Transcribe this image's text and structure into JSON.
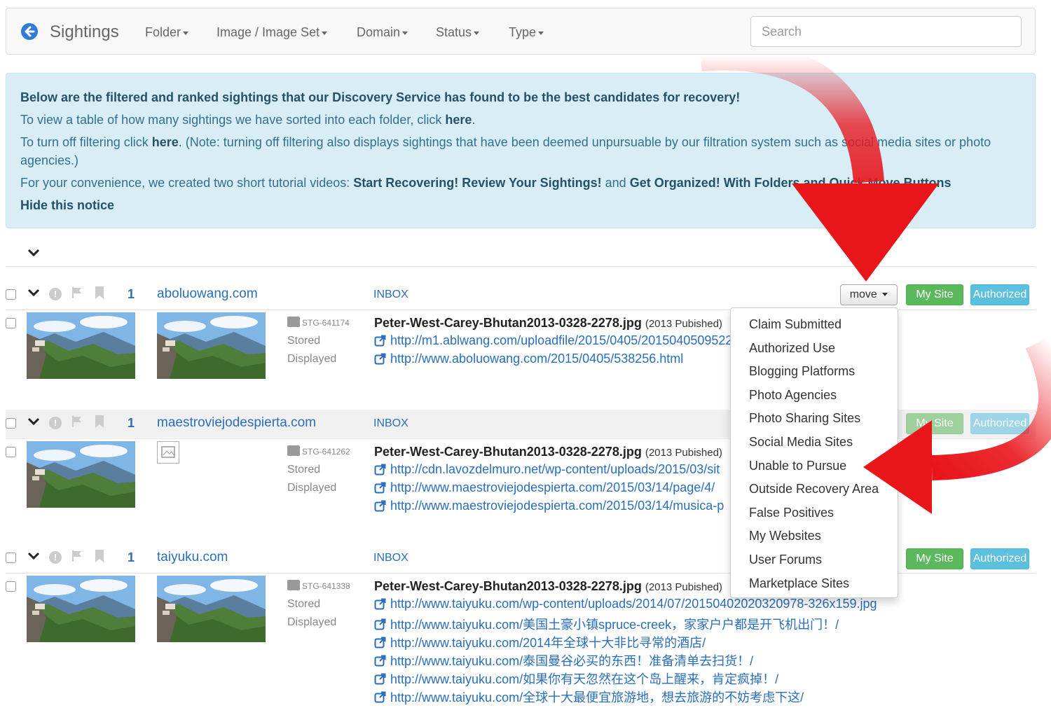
{
  "nav": {
    "brand": "Sightings",
    "menus": [
      "Folder",
      "Image / Image Set",
      "Domain",
      "Status",
      "Type"
    ],
    "search_placeholder": "Search"
  },
  "notice": {
    "line1": "Below are the filtered and ranked sightings that our Discovery Service has found to be the best candidates for recovery!",
    "line2_a": "To view a table of how many sightings we have sorted into each folder, click ",
    "line2_link": "here",
    "line2_b": ".",
    "line3_a": "To turn off filtering click ",
    "line3_link": "here",
    "line3_b": ". (Note: turning off filtering also displays sightings that have been deemed unpursuable by our filtration system such as social media sites or photo",
    "line3_c": "agencies.)",
    "line4_a": "For your convenience, we created two short tutorial videos: ",
    "line4_link1": "Start Recovering! Review Your Sightings!",
    "line4_and": " and ",
    "line4_link2": "Get Organized! With Folders and Quick Move Buttons",
    "hide": "Hide this notice"
  },
  "buttons": {
    "move": "move",
    "my_site": "My Site",
    "authorized": "Authorized"
  },
  "sightings": [
    {
      "count": "1",
      "domain": "aboluowang.com",
      "folder": "INBOX",
      "stg_id": "STG-641174",
      "stored": "Stored",
      "displayed": "Displayed",
      "filename": "Peter-West-Carey-Bhutan2013-0328-2278.jpg",
      "published": "(2013 Pubished)",
      "urls": [
        "http://m1.ablwang.com/uploadfile/2015/0405/2015040509522",
        "http://www.aboluowang.com/2015/0405/538256.html"
      ]
    },
    {
      "count": "1",
      "domain": "maestroviejodespierta.com",
      "folder": "INBOX",
      "stg_id": "STG-641262",
      "stored": "Stored",
      "displayed": "Displayed",
      "filename": "Peter-West-Carey-Bhutan2013-0328-2278.jpg",
      "published": "(2013 Pubished)",
      "urls": [
        "http://cdn.lavozdelmuro.net/wp-content/uploads/2015/03/sit",
        "http://www.maestroviejodespierta.com/2015/03/14/page/4/",
        "http://www.maestroviejodespierta.com/2015/03/14/musica-p"
      ]
    },
    {
      "count": "1",
      "domain": "taiyuku.com",
      "folder": "INBOX",
      "stg_id": "STG-641338",
      "stored": "Stored",
      "displayed": "Displayed",
      "filename": "Peter-West-Carey-Bhutan2013-0328-2278.jpg",
      "published": "(2013 Pubished)",
      "urls": [
        "http://www.taiyuku.com/wp-content/uploads/2014/07/20150402020320978-326x159.jpg",
        "http://www.taiyuku.com/美国土豪小镇spruce-creek，家家户户都是开飞机出门！/",
        "http://www.taiyuku.com/2014年全球十大非比寻常的酒店/",
        "http://www.taiyuku.com/泰国曼谷必买的东西！准备清单去扫货！/",
        "http://www.taiyuku.com/如果你有天忽然在这个岛上醒来，肯定疯掉！/",
        "http://www.taiyuku.com/全球十大最便宜旅游地，想去旅游的不妨考虑下这/"
      ]
    }
  ],
  "move_menu": [
    "Claim Submitted",
    "Authorized Use",
    "Blogging Platforms",
    "Photo Agencies",
    "Photo Sharing Sites",
    "Social Media Sites",
    "Unable to Pursue",
    "Outside Recovery Area",
    "False Positives",
    "My Websites",
    "User Forums",
    "Marketplace Sites"
  ],
  "colors": {
    "arrow": "#e8151b",
    "link": "#2a6ebb",
    "notice_bg": "#d9edf7",
    "success": "#5cb85c",
    "info": "#5bc0de"
  },
  "icons": [
    "back-arrow-icon",
    "chevron-down-icon",
    "exclamation-icon",
    "flag-icon",
    "bookmark-icon",
    "image-icon",
    "external-link-icon",
    "broken-image-icon"
  ]
}
